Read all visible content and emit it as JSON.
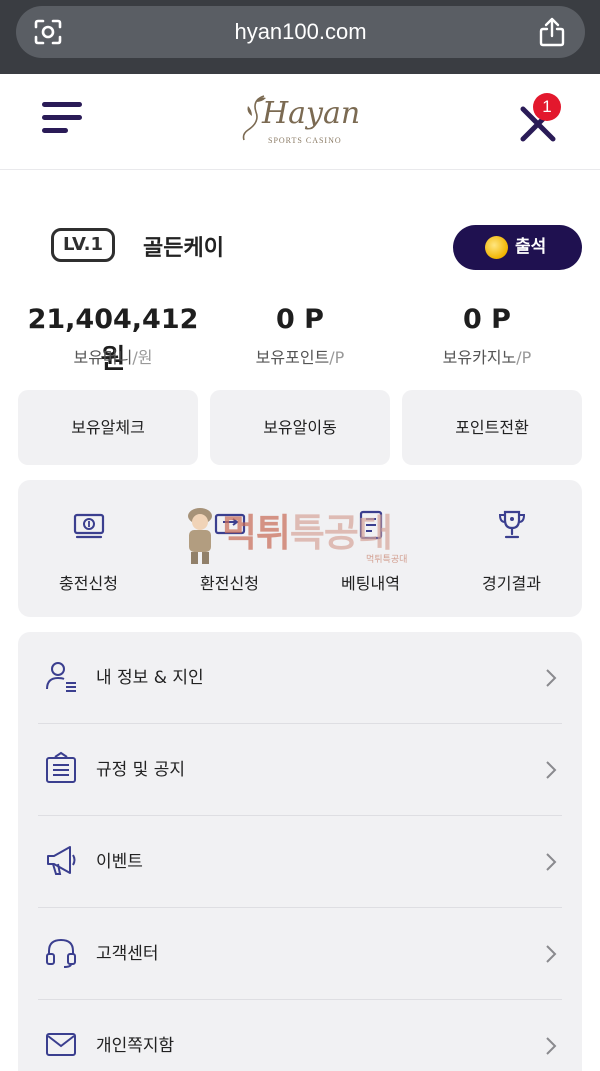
{
  "browser": {
    "url": "hyan100.com",
    "left_icon": "camera-scan-icon",
    "right_icon": "share-icon"
  },
  "header": {
    "menu_icon": "hamburger-menu-icon",
    "logo_text": "Hayan",
    "logo_sub": "SPORTS CASINO",
    "close_icon": "close-icon",
    "notification_count": "1"
  },
  "profile": {
    "level": "LV.1",
    "username": "골든케이",
    "attendance_label": "출석"
  },
  "stats": [
    {
      "value": "21,404,412 원",
      "label": "보유머니",
      "unit": "/원"
    },
    {
      "value": "0 P",
      "label": "보유포인트",
      "unit": "/P"
    },
    {
      "value": "0 P",
      "label": "보유카지노",
      "unit": "/P"
    }
  ],
  "actions": [
    {
      "label": "보유알체크"
    },
    {
      "label": "보유알이동"
    },
    {
      "label": "포인트전환"
    }
  ],
  "quick_menu": [
    {
      "label": "충전신청",
      "icon": "money-icon"
    },
    {
      "label": "환전신청",
      "icon": "exchange-icon"
    },
    {
      "label": "베팅내역",
      "icon": "betting-list-icon"
    },
    {
      "label": "경기결과",
      "icon": "trophy-icon"
    }
  ],
  "menu": [
    {
      "label": "내 정보 & 지인",
      "icon": "user-icon"
    },
    {
      "label": "규정 및 공지",
      "icon": "notice-icon"
    },
    {
      "label": "이벤트",
      "icon": "megaphone-icon"
    },
    {
      "label": "고객센터",
      "icon": "headset-icon"
    },
    {
      "label": "개인쪽지함",
      "icon": "mail-icon"
    }
  ],
  "watermark": {
    "text_a": "먹튀",
    "text_b": "특공대",
    "small": "먹튀특공대"
  },
  "colors": {
    "brand_navy": "#1f1150",
    "icon_navy": "#3b3f8f",
    "badge_red": "#e3182d",
    "card_bg": "#f1f1f3"
  }
}
